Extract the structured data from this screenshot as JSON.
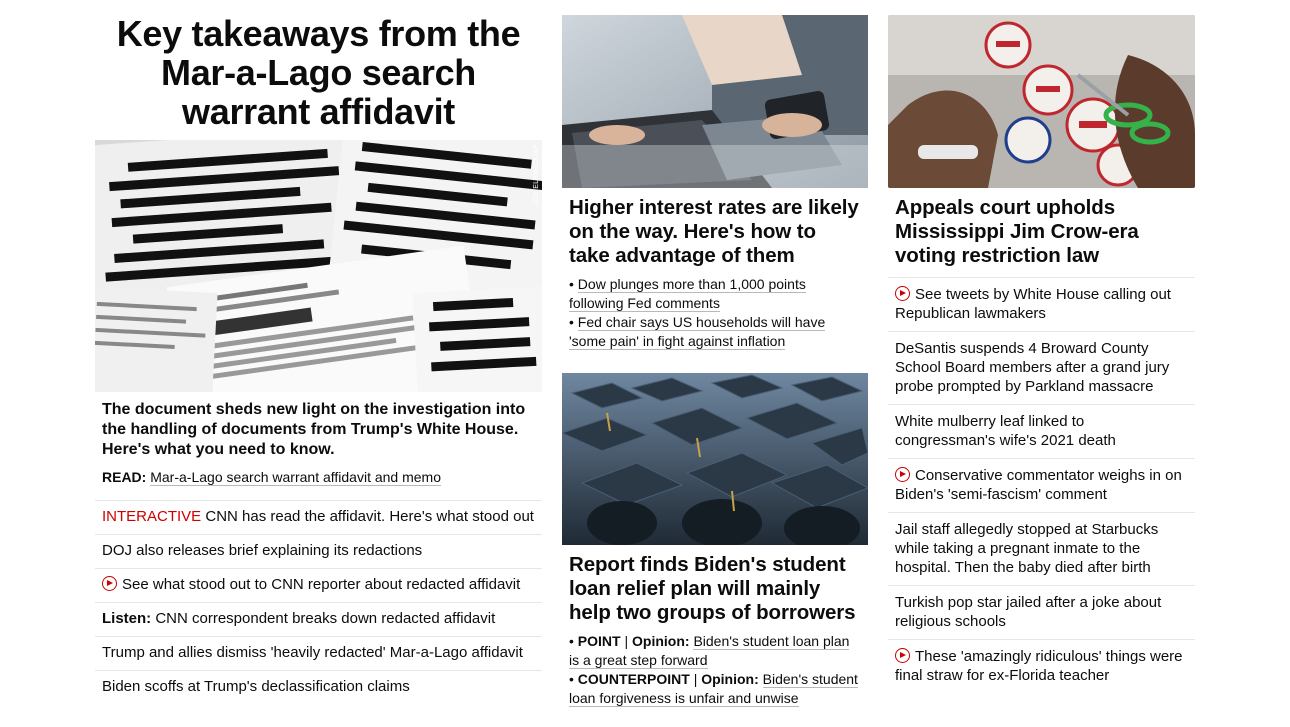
{
  "lead": {
    "headline": "Key takeaways from the Mar-a-Lago search warrant affidavit",
    "image_icon": "redacted-documents-photo",
    "photo_credit": "JON ELSWICK/AP",
    "description": "The document sheds new light on the investigation into the handling of documents from Trump's White House. Here's what you need to know.",
    "read_label": "READ:",
    "read_link": "Mar-a-Lago search warrant affidavit and memo",
    "list": [
      {
        "kicker": "INTERACTIVE",
        "text": "CNN has read the affidavit. Here's what stood out"
      },
      {
        "text": "DOJ also releases brief explaining its redactions"
      },
      {
        "icon": "play-icon",
        "text": "See what stood out to CNN reporter about redacted affidavit"
      },
      {
        "label": "Listen:",
        "text": "CNN correspondent breaks down redacted affidavit"
      },
      {
        "text": "Trump and allies dismiss 'heavily redacted' Mar-a-Lago affidavit"
      },
      {
        "text": "Biden scoffs at Trump's declassification claims"
      }
    ]
  },
  "middle": {
    "card1": {
      "image_icon": "finance-laptop-phone-photo",
      "title": "Higher interest rates are likely on the way. Here's how to take advantage of them",
      "bullets": [
        "Dow plunges more than 1,000 points following Fed comments",
        "Fed chair says US households will have 'some pain' in fight against inflation"
      ]
    },
    "card2": {
      "image_icon": "graduation-caps-photo",
      "title": "Report finds Biden's student loan relief plan will mainly help two groups of borrowers",
      "bullets": [
        {
          "tag": "POINT",
          "sep": "|",
          "label": "Opinion:",
          "text": "Biden's student loan plan is a great step forward"
        },
        {
          "tag": "COUNTERPOINT",
          "sep": "|",
          "label": "Opinion:",
          "text": "Biden's student loan forgiveness is unfair and unwise"
        }
      ]
    }
  },
  "right": {
    "image_icon": "i-voted-stickers-photo",
    "title": "Appeals court upholds Mississippi Jim Crow-era voting restriction law",
    "list": [
      {
        "icon": "play-icon",
        "text": "See tweets by White House calling out Republican lawmakers"
      },
      {
        "text": "DeSantis suspends 4 Broward County School Board members after a grand jury probe prompted by Parkland massacre"
      },
      {
        "text": "White mulberry leaf linked to congressman's wife's 2021 death"
      },
      {
        "icon": "play-icon",
        "text": "Conservative commentator weighs in on Biden's 'semi-fascism' comment"
      },
      {
        "text": "Jail staff allegedly stopped at Starbucks while taking a pregnant inmate to the hospital. Then the baby died after birth"
      },
      {
        "text": "Turkish pop star jailed after a joke about religious schools"
      },
      {
        "icon": "play-icon",
        "text": "These 'amazingly ridiculous' things were final straw for ex-Florida teacher"
      }
    ]
  },
  "colors": {
    "accent_red": "#cc0000",
    "text": "#0c0c0c",
    "divider": "#e6e6e6"
  }
}
